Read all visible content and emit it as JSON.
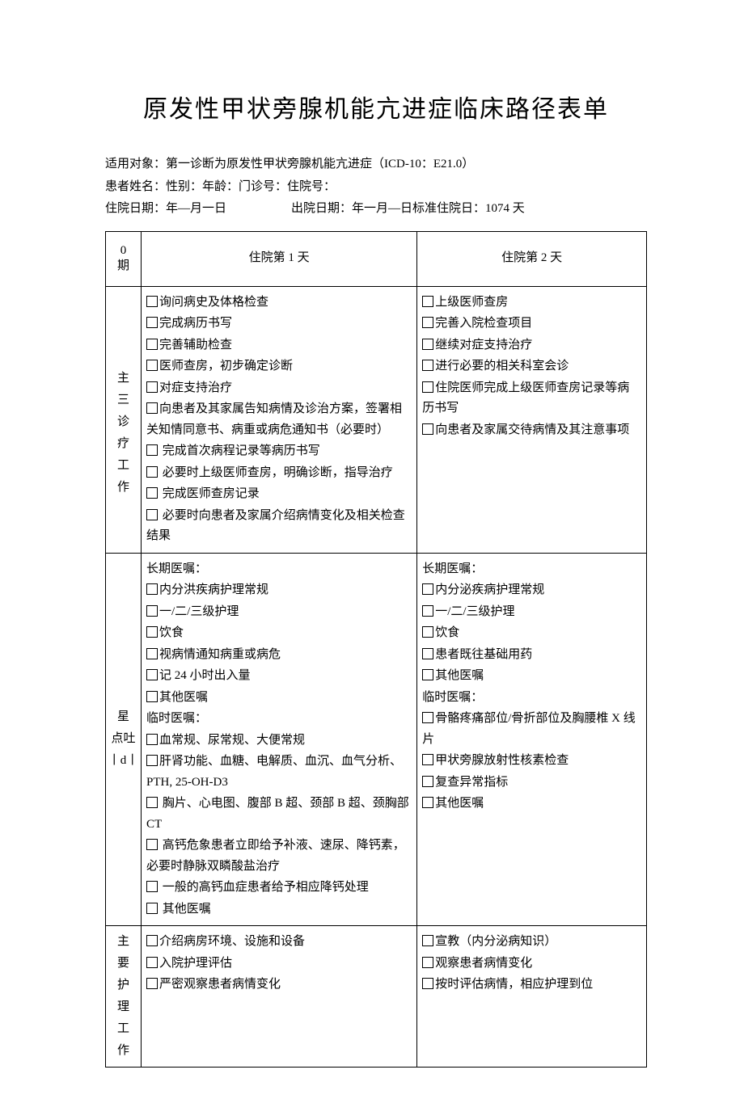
{
  "title": "原发性甲状旁腺机能亢进症临床路径表单",
  "meta": {
    "line1": "适用对象：第一诊断为原发性甲状旁腺机能亢进症（ICD-10：E21.0）",
    "line2": "患者姓名：性别：年龄：门诊号：住院号：",
    "line3_left": "住院日期：年—月一日",
    "line3_right": "出院日期：年一月—日标准住院日：1074 天"
  },
  "colheads": {
    "period": {
      "l1": "0",
      "l2": "期"
    },
    "day1": "住院第 1 天",
    "day2": "住院第 2 天"
  },
  "rows": {
    "main_work": {
      "label": [
        "主",
        "三",
        "诊",
        "疗",
        "工",
        "作"
      ],
      "d1": [
        {
          "cb": true,
          "text": "询问病史及体格检查"
        },
        {
          "cb": true,
          "text": "完成病历书写"
        },
        {
          "cb": true,
          "text": "完善辅助检查"
        },
        {
          "cb": true,
          "text": "医师查房，初步确定诊断"
        },
        {
          "cb": true,
          "text": "对症支持治疗"
        },
        {
          "cb": true,
          "text": "向患者及其家属告知病情及诊治方案，签署相关知情同意书、病重或病危通知书（必要时）"
        },
        {
          "cb": true,
          "text": "完成首次病程记录等病历书写",
          "space": true
        },
        {
          "cb": true,
          "text": "必要时上级医师查房，明确诊断，指导治疗",
          "space": true
        },
        {
          "cb": true,
          "text": "完成医师查房记录",
          "space": true
        },
        {
          "cb": true,
          "text": "必要时向患者及家属介绍病情变化及相关检查结果",
          "space": true
        }
      ],
      "d2": [
        {
          "cb": true,
          "text": "上级医师查房"
        },
        {
          "cb": true,
          "text": "完善入院检查项目"
        },
        {
          "cb": true,
          "text": "继续对症支持治疗"
        },
        {
          "cb": true,
          "text": "进行必要的相关科室会诊"
        },
        {
          "cb": true,
          "text": "住院医师完成上级医师查房记录等病历书写"
        },
        {
          "cb": true,
          "text": "向患者及家属交待病情及其注意事项"
        }
      ]
    },
    "orders": {
      "label": [
        "星",
        "点吐",
        "丨d丨"
      ],
      "d1": [
        {
          "cb": false,
          "text": "长期医嘱："
        },
        {
          "cb": true,
          "text": "内分洪疾病护理常规"
        },
        {
          "cb": true,
          "text": "一/二/三级护理"
        },
        {
          "cb": true,
          "text": "饮食"
        },
        {
          "cb": true,
          "text": "视病情通知病重或病危"
        },
        {
          "cb": true,
          "text": "记 24 小时出入量"
        },
        {
          "cb": true,
          "text": "其他医嘱"
        },
        {
          "cb": false,
          "text": "临时医嘱："
        },
        {
          "cb": true,
          "text": "血常规、尿常规、大便常规"
        },
        {
          "cb": true,
          "text": "肝肾功能、血糖、电解质、血沉、血气分析、PTH, 25-OH-D3"
        },
        {
          "cb": true,
          "text": "胸片、心电图、腹部 B 超、颈部 B 超、颈胸部 CT",
          "space": true
        },
        {
          "cb": true,
          "text": "高钙危象患者立即给予补液、速尿、降钙素，必要时静脉双瞵酸盐治疗",
          "space": true
        },
        {
          "cb": true,
          "text": "一般的高钙血症患者给予相应降钙处理",
          "space": true
        },
        {
          "cb": true,
          "text": "其他医嘱",
          "space": true
        }
      ],
      "d2": [
        {
          "cb": false,
          "text": "长期医嘱："
        },
        {
          "cb": true,
          "text": "内分泌疾病护理常规"
        },
        {
          "cb": true,
          "text": "一/二/三级护理"
        },
        {
          "cb": true,
          "text": "饮食"
        },
        {
          "cb": true,
          "text": "患者既往基础用药"
        },
        {
          "cb": true,
          "text": "其他医嘱"
        },
        {
          "cb": false,
          "text": "临时医嘱："
        },
        {
          "cb": true,
          "text": "骨骼疼痛部位/骨折部位及胸腰椎 X 线片"
        },
        {
          "cb": true,
          "text": "甲状旁腺放射性核素检查"
        },
        {
          "cb": true,
          "text": "复查异常指标"
        },
        {
          "cb": true,
          "text": "其他医嘱"
        }
      ]
    },
    "nursing": {
      "label": [
        "主",
        "要",
        "护",
        "理",
        "工",
        "作"
      ],
      "d1": [
        {
          "cb": true,
          "text": "介绍病房环境、设施和设备"
        },
        {
          "cb": true,
          "text": "入院护理评估"
        },
        {
          "cb": true,
          "text": "严密观察患者病情变化"
        }
      ],
      "d2": [
        {
          "cb": true,
          "text": "宣教（内分泌病知识）"
        },
        {
          "cb": true,
          "text": "观察患者病情变化"
        },
        {
          "cb": true,
          "text": "按时评估病情，相应护理到位"
        }
      ]
    }
  }
}
